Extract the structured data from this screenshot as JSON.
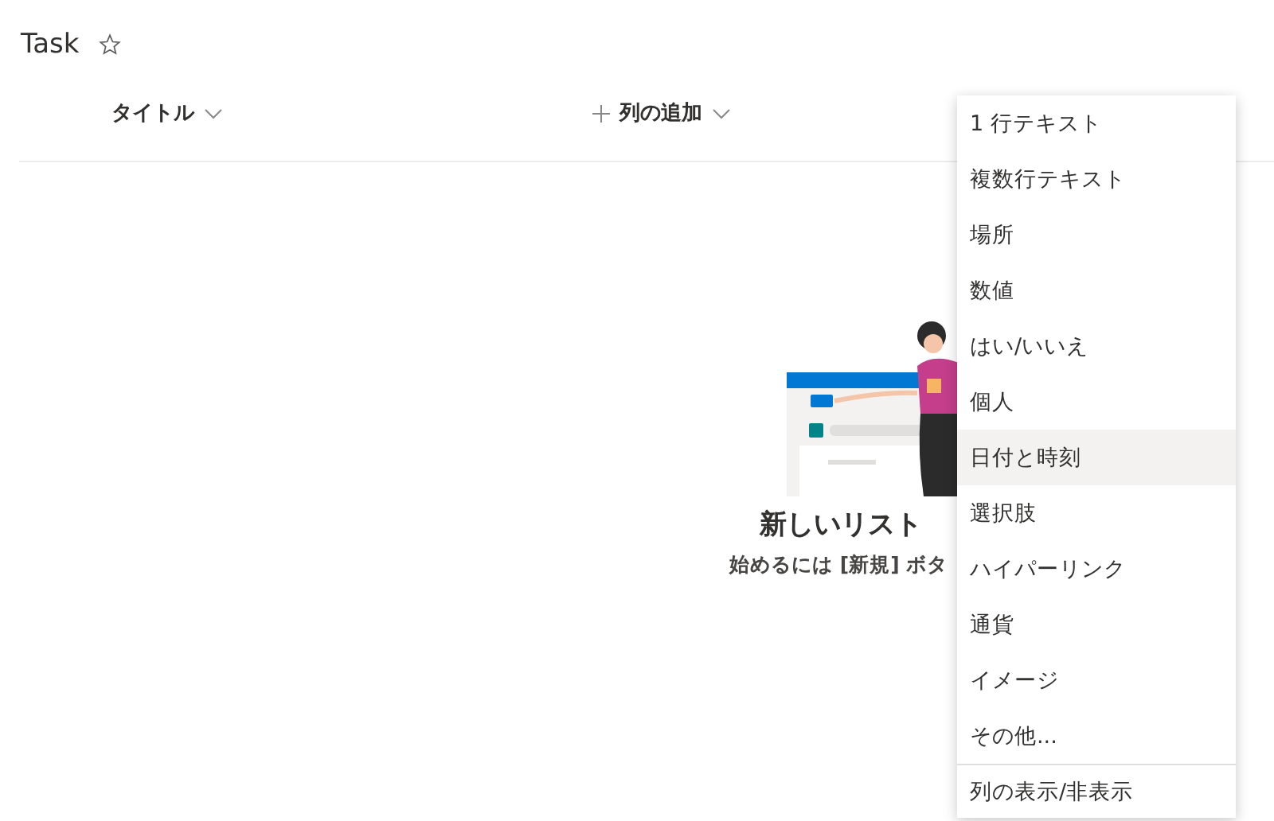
{
  "page": {
    "title": "Task",
    "favorite": false
  },
  "columns": [
    {
      "label": "タイトル",
      "kind": "field"
    },
    {
      "label": "列の追加",
      "kind": "add"
    }
  ],
  "empty_state": {
    "kind": "picture",
    "heading": "新しいリスト",
    "hint": "始めるには [新規] ボタ"
  },
  "menu": [
    {
      "label": "1 行テキスト",
      "kind": "item",
      "selected": false
    },
    {
      "label": "複数行テキスト",
      "kind": "item",
      "selected": false
    },
    {
      "label": "場所",
      "kind": "item",
      "selected": false
    },
    {
      "label": "数値",
      "kind": "item",
      "selected": false
    },
    {
      "label": "はい/いいえ",
      "kind": "item",
      "selected": false
    },
    {
      "label": "個人",
      "kind": "item",
      "selected": false
    },
    {
      "label": "日付と時刻",
      "kind": "item",
      "selected": true
    },
    {
      "label": "選択肢",
      "kind": "item",
      "selected": false
    },
    {
      "label": "ハイパーリンク",
      "kind": "item",
      "selected": false
    },
    {
      "label": "通貨",
      "kind": "item",
      "selected": false
    },
    {
      "label": "イメージ",
      "kind": "item",
      "selected": false
    },
    {
      "label": "その他...",
      "kind": "item",
      "selected": false
    },
    {
      "label": "列の表示/非表示",
      "kind": "action",
      "selected": false
    }
  ]
}
